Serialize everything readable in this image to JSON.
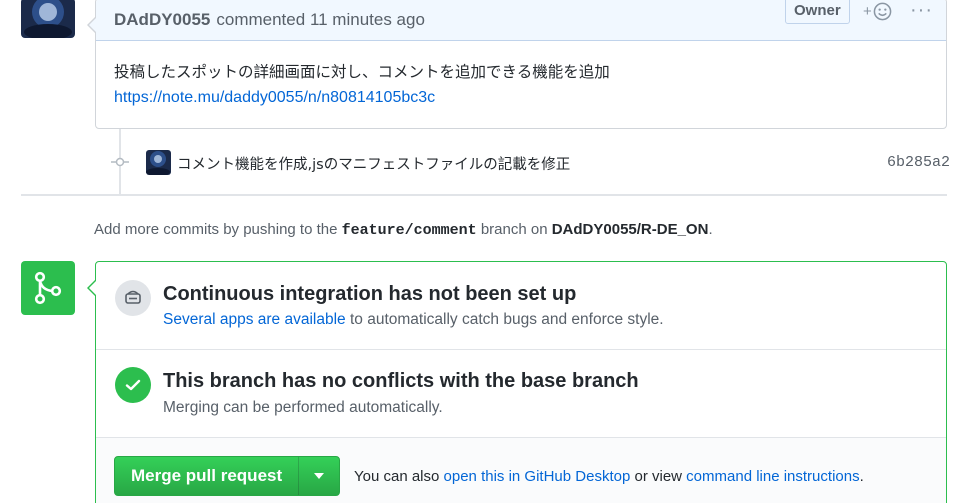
{
  "comment": {
    "author": "DAdDY0055",
    "action": "commented",
    "time": "11 minutes ago",
    "badge": "Owner",
    "reaction_plus": "+",
    "more": "···",
    "text": "投稿したスポットの詳細画面に対し、コメントを追加できる機能を追加",
    "link": "https://note.mu/daddy0055/n/n80814105bc3c"
  },
  "commit": {
    "message": "コメント機能を作成,jsのマニフェストファイルの記載を修正",
    "sha": "6b285a2"
  },
  "push_hint": {
    "prefix": "Add more commits by pushing to the ",
    "branch": "feature/comment",
    "middle": " branch on ",
    "repo": "DAdDY0055/R-DE_ON",
    "suffix": "."
  },
  "ci": {
    "title": "Continuous integration has not been set up",
    "link_text": "Several apps are available",
    "rest": " to automatically catch bugs and enforce style."
  },
  "conflicts": {
    "title": "This branch has no conflicts with the base branch",
    "subtitle": "Merging can be performed automatically."
  },
  "merge": {
    "button_label": "Merge pull request",
    "alt_prefix": "You can also ",
    "desktop_link": "open this in GitHub Desktop",
    "alt_middle": " or view ",
    "cli_link": "command line instructions",
    "alt_suffix": "."
  },
  "colors": {
    "success": "#2cbe4e",
    "link": "#0366d6",
    "header_bg": "#f1f8ff"
  }
}
